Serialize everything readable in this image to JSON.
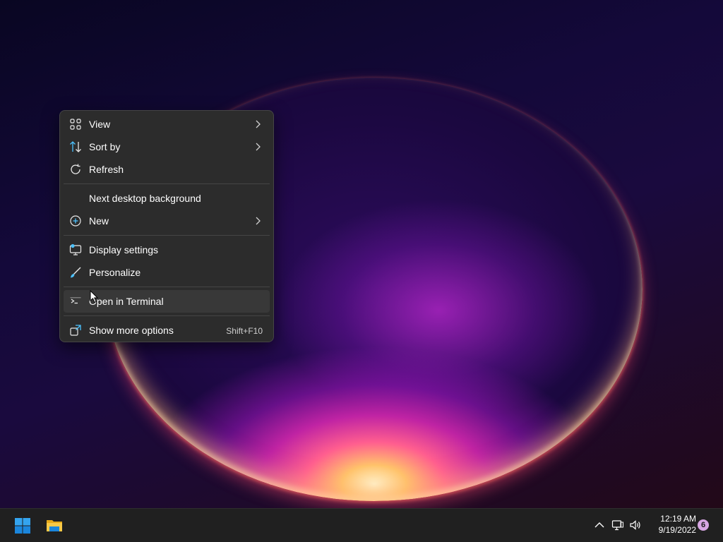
{
  "context_menu": {
    "items": [
      {
        "label": "View",
        "icon": "view-grid-icon",
        "has_submenu": true
      },
      {
        "label": "Sort by",
        "icon": "sort-arrows-icon",
        "has_submenu": true
      },
      {
        "label": "Refresh",
        "icon": "refresh-icon",
        "has_submenu": false
      },
      {
        "label": "Next desktop background",
        "icon": "",
        "has_submenu": false
      },
      {
        "label": "New",
        "icon": "plus-circle-icon",
        "has_submenu": true
      },
      {
        "label": "Display settings",
        "icon": "display-icon",
        "has_submenu": false
      },
      {
        "label": "Personalize",
        "icon": "paintbrush-icon",
        "has_submenu": false
      },
      {
        "label": "Open in Terminal",
        "icon": "terminal-icon",
        "has_submenu": false,
        "hovered": true
      },
      {
        "label": "Show more options",
        "icon": "expand-icon",
        "shortcut": "Shift+F10"
      }
    ]
  },
  "taskbar": {
    "start_icon": "windows-logo-icon",
    "pinned": [
      {
        "name": "File Explorer",
        "icon": "folder-icon"
      }
    ],
    "tray": {
      "icons": [
        "chevron-up-icon",
        "network-icon",
        "volume-icon"
      ],
      "time": "12:19 AM",
      "date": "9/19/2022",
      "notification_count": "6"
    }
  },
  "colors": {
    "menu_bg": "#2c2c2c",
    "menu_hover": "#383838",
    "taskbar_bg": "#202020",
    "accent": "#4cc2ff",
    "start_blue": "#0078d4",
    "folder_yellow": "#f7c948",
    "badge": "#d7a6e3"
  }
}
